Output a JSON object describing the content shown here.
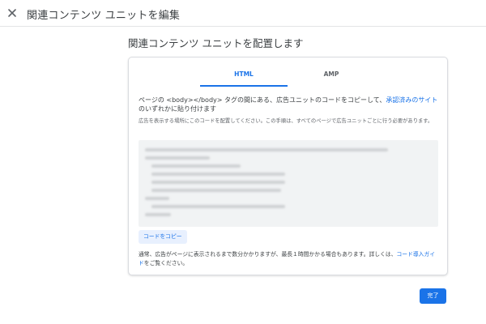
{
  "header": {
    "title": "関連コンテンツ ユニットを編集",
    "close_icon": "close-icon"
  },
  "main": {
    "heading": "関連コンテンツ ユニットを配置します",
    "tabs": [
      {
        "label": "HTML",
        "selected": true
      },
      {
        "label": "AMP",
        "selected": false
      }
    ],
    "instruction_before": "ページの <body></body> タグの間にある、広告ユニットのコードをコピーして、",
    "instruction_link": "承認済みのサイト",
    "instruction_after": "のいずれかに貼り付けます",
    "sub_instruction": "広告を表示する場所にこのコードを配置してください。この手順は、すべてのページで広告ユニットごとに行う必要があります。",
    "copy_button": "コードをコピー",
    "footnote_before": "通常、広告がページに表示されるまで数分かかりますが、最長１時間かかる場合もあります。詳しくは、",
    "footnote_link": "コード導入ガイド",
    "footnote_after": "をご覧ください。",
    "done_button": "完了"
  },
  "colors": {
    "accent": "#1a73e8",
    "code_bg": "#f1f3f4",
    "border": "#dadce0"
  }
}
